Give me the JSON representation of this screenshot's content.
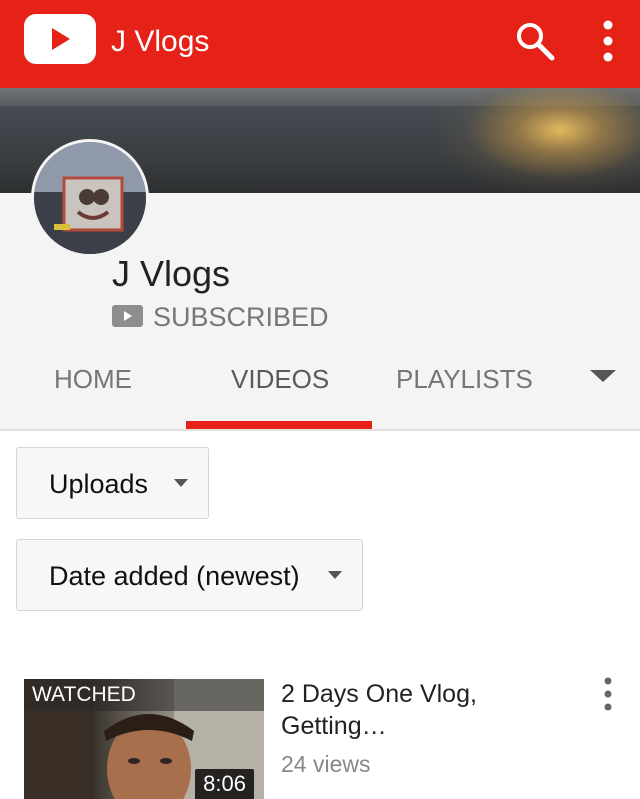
{
  "header": {
    "title": "J Vlogs",
    "logo_icon": "youtube-logo-icon",
    "search_icon": "search-icon",
    "menu_icon": "more-vert-icon",
    "color": "#e62117"
  },
  "channel": {
    "name": "J Vlogs",
    "subscribe_label": "SUBSCRIBED"
  },
  "tabs": [
    {
      "label": "HOME",
      "active": false
    },
    {
      "label": "VIDEOS",
      "active": true
    },
    {
      "label": "PLAYLISTS",
      "active": false
    }
  ],
  "filters": {
    "uploads_label": "Uploads",
    "sort_label": "Date added (newest)"
  },
  "videos": [
    {
      "watched_label": "WATCHED",
      "duration": "8:06",
      "title": "2 Days One Vlog, Getting…",
      "views": "24 views"
    }
  ]
}
